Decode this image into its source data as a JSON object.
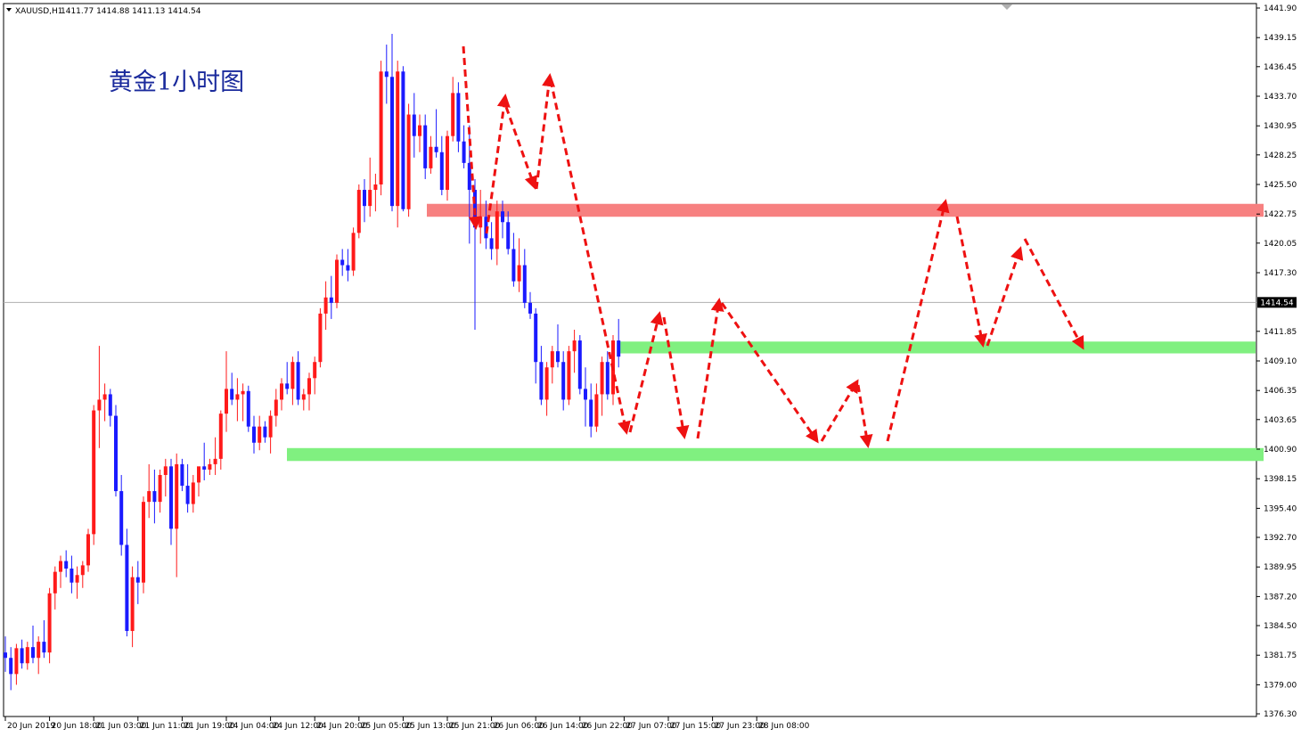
{
  "header": {
    "symbol": "XAUUSD,H1",
    "ohlc": "1411.77 1414.88 1411.13 1414.54"
  },
  "annotation": {
    "title": "黄金1小时图"
  },
  "price_box": {
    "label": "1414.54"
  },
  "colors": {
    "bull": "#ff1a1a",
    "bear": "#1a1aff",
    "resistance_zone": "#f78080",
    "support_zone": "#80f080",
    "arrow": "#ee1111",
    "title": "#1a2a9c"
  },
  "chart_data": {
    "type": "candlestick",
    "symbol": "XAUUSD",
    "timeframe": "H1",
    "ylim": [
      1376.3,
      1441.9
    ],
    "y_ticks": [
      "1441.90",
      "1439.15",
      "1436.45",
      "1433.70",
      "1430.95",
      "1428.25",
      "1425.50",
      "1422.75",
      "1420.05",
      "1417.30",
      "1414.54",
      "1411.85",
      "1409.10",
      "1406.35",
      "1403.65",
      "1400.90",
      "1398.15",
      "1395.40",
      "1392.70",
      "1389.95",
      "1387.20",
      "1384.50",
      "1381.75",
      "1379.00",
      "1376.30"
    ],
    "x_labels": [
      "20 Jun 2019",
      "20 Jun 18:00",
      "21 Jun 03:00",
      "21 Jun 11:00",
      "21 Jun 19:00",
      "24 Jun 04:00",
      "24 Jun 12:00",
      "24 Jun 20:00",
      "25 Jun 05:00",
      "25 Jun 13:00",
      "25 Jun 21:00",
      "26 Jun 06:00",
      "26 Jun 14:00",
      "26 Jun 22:00",
      "27 Jun 07:00",
      "27 Jun 15:00",
      "27 Jun 23:00",
      "28 Jun 08:00"
    ],
    "x_label_index": [
      0,
      8,
      16,
      24,
      32,
      40,
      48,
      56,
      64,
      72,
      80,
      88,
      96,
      104,
      112,
      120,
      128,
      136
    ],
    "current_price": 1414.54,
    "candles": [
      [
        1382.0,
        1383.5,
        1380.2,
        1381.5
      ],
      [
        1381.5,
        1382.5,
        1378.5,
        1380.0
      ],
      [
        1380.0,
        1382.8,
        1379.0,
        1382.4
      ],
      [
        1382.4,
        1383.2,
        1380.5,
        1381.0
      ],
      [
        1381.0,
        1383.0,
        1380.4,
        1382.5
      ],
      [
        1382.5,
        1384.5,
        1381.0,
        1381.5
      ],
      [
        1381.5,
        1383.5,
        1380.0,
        1383.0
      ],
      [
        1383.0,
        1385.0,
        1381.5,
        1382.0
      ],
      [
        1382.0,
        1388.0,
        1381.0,
        1387.5
      ],
      [
        1387.5,
        1390.0,
        1386.0,
        1389.5
      ],
      [
        1389.5,
        1391.0,
        1388.0,
        1390.5
      ],
      [
        1390.5,
        1391.5,
        1389.0,
        1389.8
      ],
      [
        1389.8,
        1391.0,
        1387.5,
        1388.5
      ],
      [
        1388.5,
        1390.0,
        1387.0,
        1389.2
      ],
      [
        1389.2,
        1390.5,
        1388.0,
        1390.1
      ],
      [
        1390.1,
        1393.5,
        1389.5,
        1393.0
      ],
      [
        1393.0,
        1405.0,
        1392.0,
        1404.5
      ],
      [
        1404.5,
        1410.5,
        1401.0,
        1405.5
      ],
      [
        1405.5,
        1407.0,
        1403.5,
        1406.0
      ],
      [
        1406.0,
        1406.5,
        1403.0,
        1404.0
      ],
      [
        1404.0,
        1405.0,
        1396.5,
        1397.0
      ],
      [
        1397.0,
        1398.5,
        1391.0,
        1392.0
      ],
      [
        1392.0,
        1393.5,
        1383.5,
        1384.0
      ],
      [
        1384.0,
        1390.0,
        1382.5,
        1389.0
      ],
      [
        1389.0,
        1390.5,
        1386.5,
        1388.5
      ],
      [
        1388.5,
        1396.5,
        1387.5,
        1396.0
      ],
      [
        1396.0,
        1399.5,
        1394.5,
        1397.0
      ],
      [
        1397.0,
        1399.0,
        1394.0,
        1396.0
      ],
      [
        1396.0,
        1399.0,
        1395.0,
        1398.5
      ],
      [
        1398.5,
        1400.0,
        1396.5,
        1399.3
      ],
      [
        1399.3,
        1400.0,
        1392.0,
        1393.5
      ],
      [
        1393.5,
        1400.5,
        1389.0,
        1399.5
      ],
      [
        1399.5,
        1400.0,
        1397.0,
        1397.5
      ],
      [
        1397.5,
        1399.5,
        1395.0,
        1395.8
      ],
      [
        1395.8,
        1398.5,
        1395.0,
        1397.8
      ],
      [
        1397.8,
        1399.0,
        1396.5,
        1399.3
      ],
      [
        1399.3,
        1401.5,
        1398.0,
        1399.0
      ],
      [
        1399.0,
        1400.0,
        1398.5,
        1399.5
      ],
      [
        1399.5,
        1402.0,
        1398.5,
        1400.0
      ],
      [
        1400.0,
        1404.5,
        1399.0,
        1404.2
      ],
      [
        1404.2,
        1410.0,
        1402.5,
        1406.5
      ],
      [
        1406.5,
        1408.0,
        1405.0,
        1405.5
      ],
      [
        1405.5,
        1407.5,
        1403.5,
        1406.0
      ],
      [
        1406.0,
        1407.0,
        1403.5,
        1406.3
      ],
      [
        1406.3,
        1406.8,
        1402.5,
        1403.0
      ],
      [
        1403.0,
        1404.0,
        1400.5,
        1401.5
      ],
      [
        1401.5,
        1404.0,
        1400.8,
        1403.0
      ],
      [
        1403.0,
        1403.5,
        1401.5,
        1402.0
      ],
      [
        1402.0,
        1404.5,
        1400.5,
        1404.0
      ],
      [
        1404.0,
        1406.5,
        1403.0,
        1405.5
      ],
      [
        1405.5,
        1407.5,
        1404.5,
        1407.0
      ],
      [
        1407.0,
        1409.0,
        1406.0,
        1406.5
      ],
      [
        1406.5,
        1409.5,
        1405.0,
        1409.0
      ],
      [
        1409.0,
        1410.0,
        1405.0,
        1405.5
      ],
      [
        1405.5,
        1406.5,
        1404.5,
        1406.0
      ],
      [
        1406.0,
        1408.0,
        1404.5,
        1407.5
      ],
      [
        1407.5,
        1409.5,
        1406.0,
        1409.0
      ],
      [
        1409.0,
        1414.0,
        1408.5,
        1413.5
      ],
      [
        1413.5,
        1416.5,
        1412.0,
        1415.0
      ],
      [
        1415.0,
        1417.0,
        1413.0,
        1414.5
      ],
      [
        1414.5,
        1419.0,
        1414.0,
        1418.5
      ],
      [
        1418.5,
        1419.5,
        1417.0,
        1418.0
      ],
      [
        1418.0,
        1419.5,
        1416.5,
        1417.5
      ],
      [
        1417.5,
        1421.5,
        1417.0,
        1421.0
      ],
      [
        1421.0,
        1425.5,
        1420.5,
        1425.0
      ],
      [
        1425.0,
        1426.0,
        1422.0,
        1423.5
      ],
      [
        1423.5,
        1428.0,
        1422.5,
        1425.0
      ],
      [
        1425.0,
        1426.5,
        1423.0,
        1425.5
      ],
      [
        1425.5,
        1437.0,
        1424.5,
        1436.0
      ],
      [
        1436.0,
        1438.5,
        1433.0,
        1435.5
      ],
      [
        1435.5,
        1439.5,
        1423.0,
        1423.5
      ],
      [
        1423.5,
        1437.0,
        1421.5,
        1436.0
      ],
      [
        1436.0,
        1436.5,
        1423.0,
        1423.2
      ],
      [
        1423.2,
        1433.0,
        1422.5,
        1432.0
      ],
      [
        1432.0,
        1434.0,
        1428.0,
        1430.0
      ],
      [
        1430.0,
        1432.0,
        1428.5,
        1431.0
      ],
      [
        1431.0,
        1432.0,
        1426.0,
        1427.0
      ],
      [
        1427.0,
        1430.0,
        1426.5,
        1429.0
      ],
      [
        1429.0,
        1432.5,
        1428.0,
        1428.5
      ],
      [
        1428.5,
        1430.0,
        1424.5,
        1425.0
      ],
      [
        1425.0,
        1430.5,
        1424.0,
        1430.0
      ],
      [
        1430.0,
        1435.5,
        1429.5,
        1434.0
      ],
      [
        1434.0,
        1435.0,
        1428.5,
        1429.5
      ],
      [
        1429.5,
        1431.0,
        1427.0,
        1427.5
      ],
      [
        1427.5,
        1431.0,
        1420.0,
        1425.0
      ],
      [
        1425.0,
        1426.0,
        1412.0,
        1421.5
      ],
      [
        1421.5,
        1425.0,
        1420.0,
        1422.5
      ],
      [
        1422.5,
        1424.0,
        1419.5,
        1420.5
      ],
      [
        1420.5,
        1422.0,
        1418.5,
        1419.5
      ],
      [
        1419.5,
        1424.0,
        1418.0,
        1423.0
      ],
      [
        1423.0,
        1424.0,
        1420.5,
        1422.0
      ],
      [
        1422.0,
        1423.0,
        1419.0,
        1419.5
      ],
      [
        1419.5,
        1421.0,
        1416.0,
        1416.5
      ],
      [
        1416.5,
        1420.5,
        1415.5,
        1418.0
      ],
      [
        1418.0,
        1419.5,
        1414.0,
        1414.5
      ],
      [
        1414.5,
        1415.5,
        1413.0,
        1413.5
      ],
      [
        1413.5,
        1414.0,
        1407.0,
        1409.0
      ],
      [
        1409.0,
        1410.5,
        1405.0,
        1405.5
      ],
      [
        1405.5,
        1409.0,
        1404.0,
        1408.5
      ],
      [
        1408.5,
        1410.5,
        1407.0,
        1410.0
      ],
      [
        1410.0,
        1412.5,
        1408.5,
        1409.0
      ],
      [
        1409.0,
        1410.0,
        1404.5,
        1405.5
      ],
      [
        1405.5,
        1410.5,
        1405.0,
        1410.0
      ],
      [
        1410.0,
        1412.0,
        1408.0,
        1411.0
      ],
      [
        1411.0,
        1411.5,
        1406.0,
        1406.5
      ],
      [
        1406.5,
        1408.5,
        1403.0,
        1405.5
      ],
      [
        1405.5,
        1407.0,
        1402.0,
        1403.0
      ],
      [
        1403.0,
        1407.0,
        1402.5,
        1406.0
      ],
      [
        1406.0,
        1409.5,
        1404.0,
        1409.0
      ],
      [
        1409.0,
        1410.0,
        1405.5,
        1406.0
      ],
      [
        1406.0,
        1411.5,
        1405.0,
        1411.0
      ],
      [
        1411.0,
        1413.0,
        1408.5,
        1409.5
      ]
    ],
    "zones": [
      {
        "name": "resistance",
        "low": 1422.5,
        "high": 1423.7
      },
      {
        "name": "support-upper",
        "low": 1409.8,
        "high": 1410.9
      },
      {
        "name": "support-lower",
        "low": 1399.8,
        "high": 1401.0
      }
    ]
  }
}
